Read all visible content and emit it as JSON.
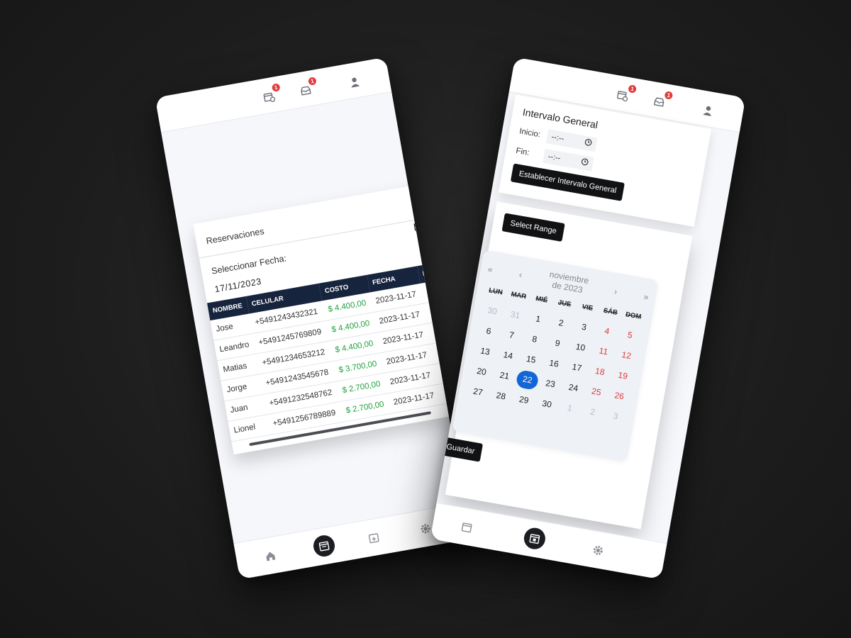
{
  "left_phone": {
    "topbar": {
      "calendar_badge": "1",
      "messages_badge": "1"
    },
    "reservations": {
      "title": "Reservaciones",
      "date_label": "Seleccionar Fecha:",
      "date_value": "17/11/2023",
      "columns": [
        "NOMBRE",
        "CELULAR",
        "COSTO",
        "FECHA",
        "H"
      ],
      "rows": [
        {
          "name": "Jose",
          "phone": "+5491243432321",
          "cost": "$ 4.400,00",
          "date": "2023-11-17"
        },
        {
          "name": "Leandro",
          "phone": "+5491245769809",
          "cost": "$ 4.400,00",
          "date": "2023-11-17"
        },
        {
          "name": "Matias",
          "phone": "+5491234653212",
          "cost": "$ 4.400,00",
          "date": "2023-11-17"
        },
        {
          "name": "Jorge",
          "phone": "+5491243545678",
          "cost": "$ 3.700,00",
          "date": "2023-11-17"
        },
        {
          "name": "Juan",
          "phone": "+5491232548762",
          "cost": "$ 2.700,00",
          "date": "2023-11-17"
        },
        {
          "name": "Lionel",
          "phone": "+5491256789889",
          "cost": "$ 2.700,00",
          "date": "2023-11-17"
        }
      ]
    }
  },
  "right_phone": {
    "topbar": {
      "calendar_badge": "1",
      "messages_badge": "1"
    },
    "interval": {
      "title": "Intervalo General",
      "start_label": "Inicio:",
      "start_value": "--:--",
      "end_label": "Fin:",
      "end_value": "--:--",
      "set_button": "Establecer Intervalo General"
    },
    "range": {
      "select_button": "Select Range",
      "save_button": "Guardar",
      "calendar": {
        "prev_year": "«",
        "prev_month": "‹",
        "month": "noviembre",
        "year": "de 2023",
        "next_month": "›",
        "next_year": "»",
        "weekdays": [
          "LUN",
          "MAR",
          "MIÉ",
          "JUE",
          "VIE",
          "SÁB",
          "DOM"
        ],
        "days": [
          {
            "d": "30",
            "t": "muted"
          },
          {
            "d": "31",
            "t": "muted"
          },
          {
            "d": "1",
            "t": ""
          },
          {
            "d": "2",
            "t": ""
          },
          {
            "d": "3",
            "t": ""
          },
          {
            "d": "4",
            "t": "weekend"
          },
          {
            "d": "5",
            "t": "weekend"
          },
          {
            "d": "6",
            "t": ""
          },
          {
            "d": "7",
            "t": ""
          },
          {
            "d": "8",
            "t": ""
          },
          {
            "d": "9",
            "t": ""
          },
          {
            "d": "10",
            "t": ""
          },
          {
            "d": "11",
            "t": "weekend"
          },
          {
            "d": "12",
            "t": "weekend"
          },
          {
            "d": "13",
            "t": ""
          },
          {
            "d": "14",
            "t": ""
          },
          {
            "d": "15",
            "t": ""
          },
          {
            "d": "16",
            "t": ""
          },
          {
            "d": "17",
            "t": ""
          },
          {
            "d": "18",
            "t": "weekend"
          },
          {
            "d": "19",
            "t": "weekend"
          },
          {
            "d": "20",
            "t": ""
          },
          {
            "d": "21",
            "t": ""
          },
          {
            "d": "22",
            "t": "selected"
          },
          {
            "d": "23",
            "t": ""
          },
          {
            "d": "24",
            "t": ""
          },
          {
            "d": "25",
            "t": "weekend"
          },
          {
            "d": "26",
            "t": "weekend"
          },
          {
            "d": "27",
            "t": ""
          },
          {
            "d": "28",
            "t": ""
          },
          {
            "d": "29",
            "t": ""
          },
          {
            "d": "30",
            "t": ""
          },
          {
            "d": "1",
            "t": "muted"
          },
          {
            "d": "2",
            "t": "muted"
          },
          {
            "d": "3",
            "t": "muted"
          }
        ]
      }
    }
  },
  "colors": {
    "accent": "#1366d6",
    "cost_green": "#1fa23c",
    "header_navy": "#17243e",
    "weekend_red": "#e03b3b"
  },
  "icons": [
    "calendar-settings-icon",
    "inbox-icon",
    "user-icon",
    "home-icon",
    "reservations-icon",
    "calendar-add-icon",
    "gear-icon"
  ]
}
